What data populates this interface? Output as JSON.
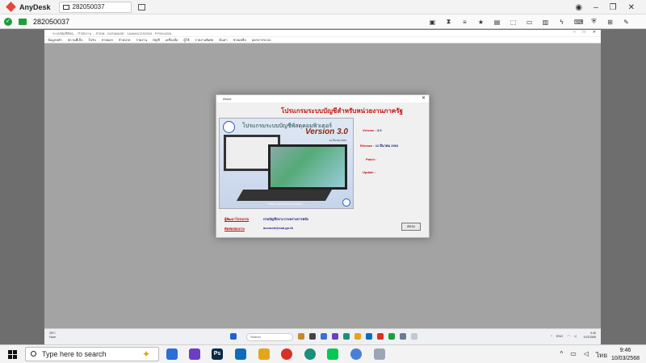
{
  "anydesk": {
    "brand": "AnyDesk",
    "tab_label": "282050037",
    "address": "282050037",
    "top_icons": [
      "globe-icon",
      "minimize-icon",
      "maximize-icon",
      "close-icon"
    ]
  },
  "remote": {
    "window_title": "ระบบบัญชีพัสดุ ... สำนักงาน ... PSDB - DATABASE - 1AAMACDS2003 - PF0004226",
    "menu": [
      "ข้อมูลหลัก",
      "สถานที่เก็บ",
      "ใบรับ",
      "จ่ายออก",
      "จำหน่าย",
      "รายงาน",
      "บัญชี",
      "เครื่องมือ",
      "ผู้ใช้",
      "รายงานพิเศษ",
      "ค้นหา",
      "ช่วยเหลือ",
      "ออกจากระบบ"
    ],
    "dialog": {
      "title": "About",
      "heading": "โปรแกรมระบบบัญชีสำหรับหน่วยงานภาครัฐ",
      "splash_title": "โปรแกรมระบบบัญชีพัสดุคอมพิวเตอร์",
      "splash_version": "Version 3.0",
      "splash_date": "12 มีนาคม 2563",
      "splash_footer": "สำนักงานคณะกรรมการกฤษฎีกา",
      "version_label": "Version :",
      "version_value": "3.0",
      "release_label": "Release :",
      "release_value": "12 มีนาคม 2563",
      "patch_label": "Patch :",
      "update_label": "Update :",
      "dev_label": "ผู้พัฒนาโปรแกรม",
      "dev_value": "กรมบัญชีกลาง กระทรวงการคลัง",
      "contact_label": "ติดต่อสอบถาม",
      "contact_value": "account@cad.go.th",
      "ok_button": "ตกลง"
    },
    "taskbar": {
      "weather_temp": "28°C",
      "weather_text": "Haze",
      "search": "Search",
      "lang": "ENG",
      "time": "9:46",
      "date": "10/3/2568"
    }
  },
  "taskbar": {
    "search_placeholder": "Type here to search",
    "lang": "ไทย",
    "time": "9:46",
    "date": "10/03/2568",
    "apps": [
      {
        "name": "explorer-icon",
        "color": "#2a6fd6"
      },
      {
        "name": "teams-icon",
        "color": "#6a3fc4"
      },
      {
        "name": "photoshop-icon",
        "color": "#0b2a4a",
        "label": "Ps"
      },
      {
        "name": "outlook-icon",
        "color": "#0f6cbd"
      },
      {
        "name": "folder-icon",
        "color": "#e3a51e"
      },
      {
        "name": "chrome-icon",
        "color": "#d93025"
      },
      {
        "name": "edge-icon",
        "color": "#1a8f7a"
      },
      {
        "name": "line-icon",
        "color": "#06c755"
      },
      {
        "name": "app-icon",
        "color": "#4a7fd8"
      },
      {
        "name": "file-icon",
        "color": "#9aa6b8"
      }
    ]
  }
}
